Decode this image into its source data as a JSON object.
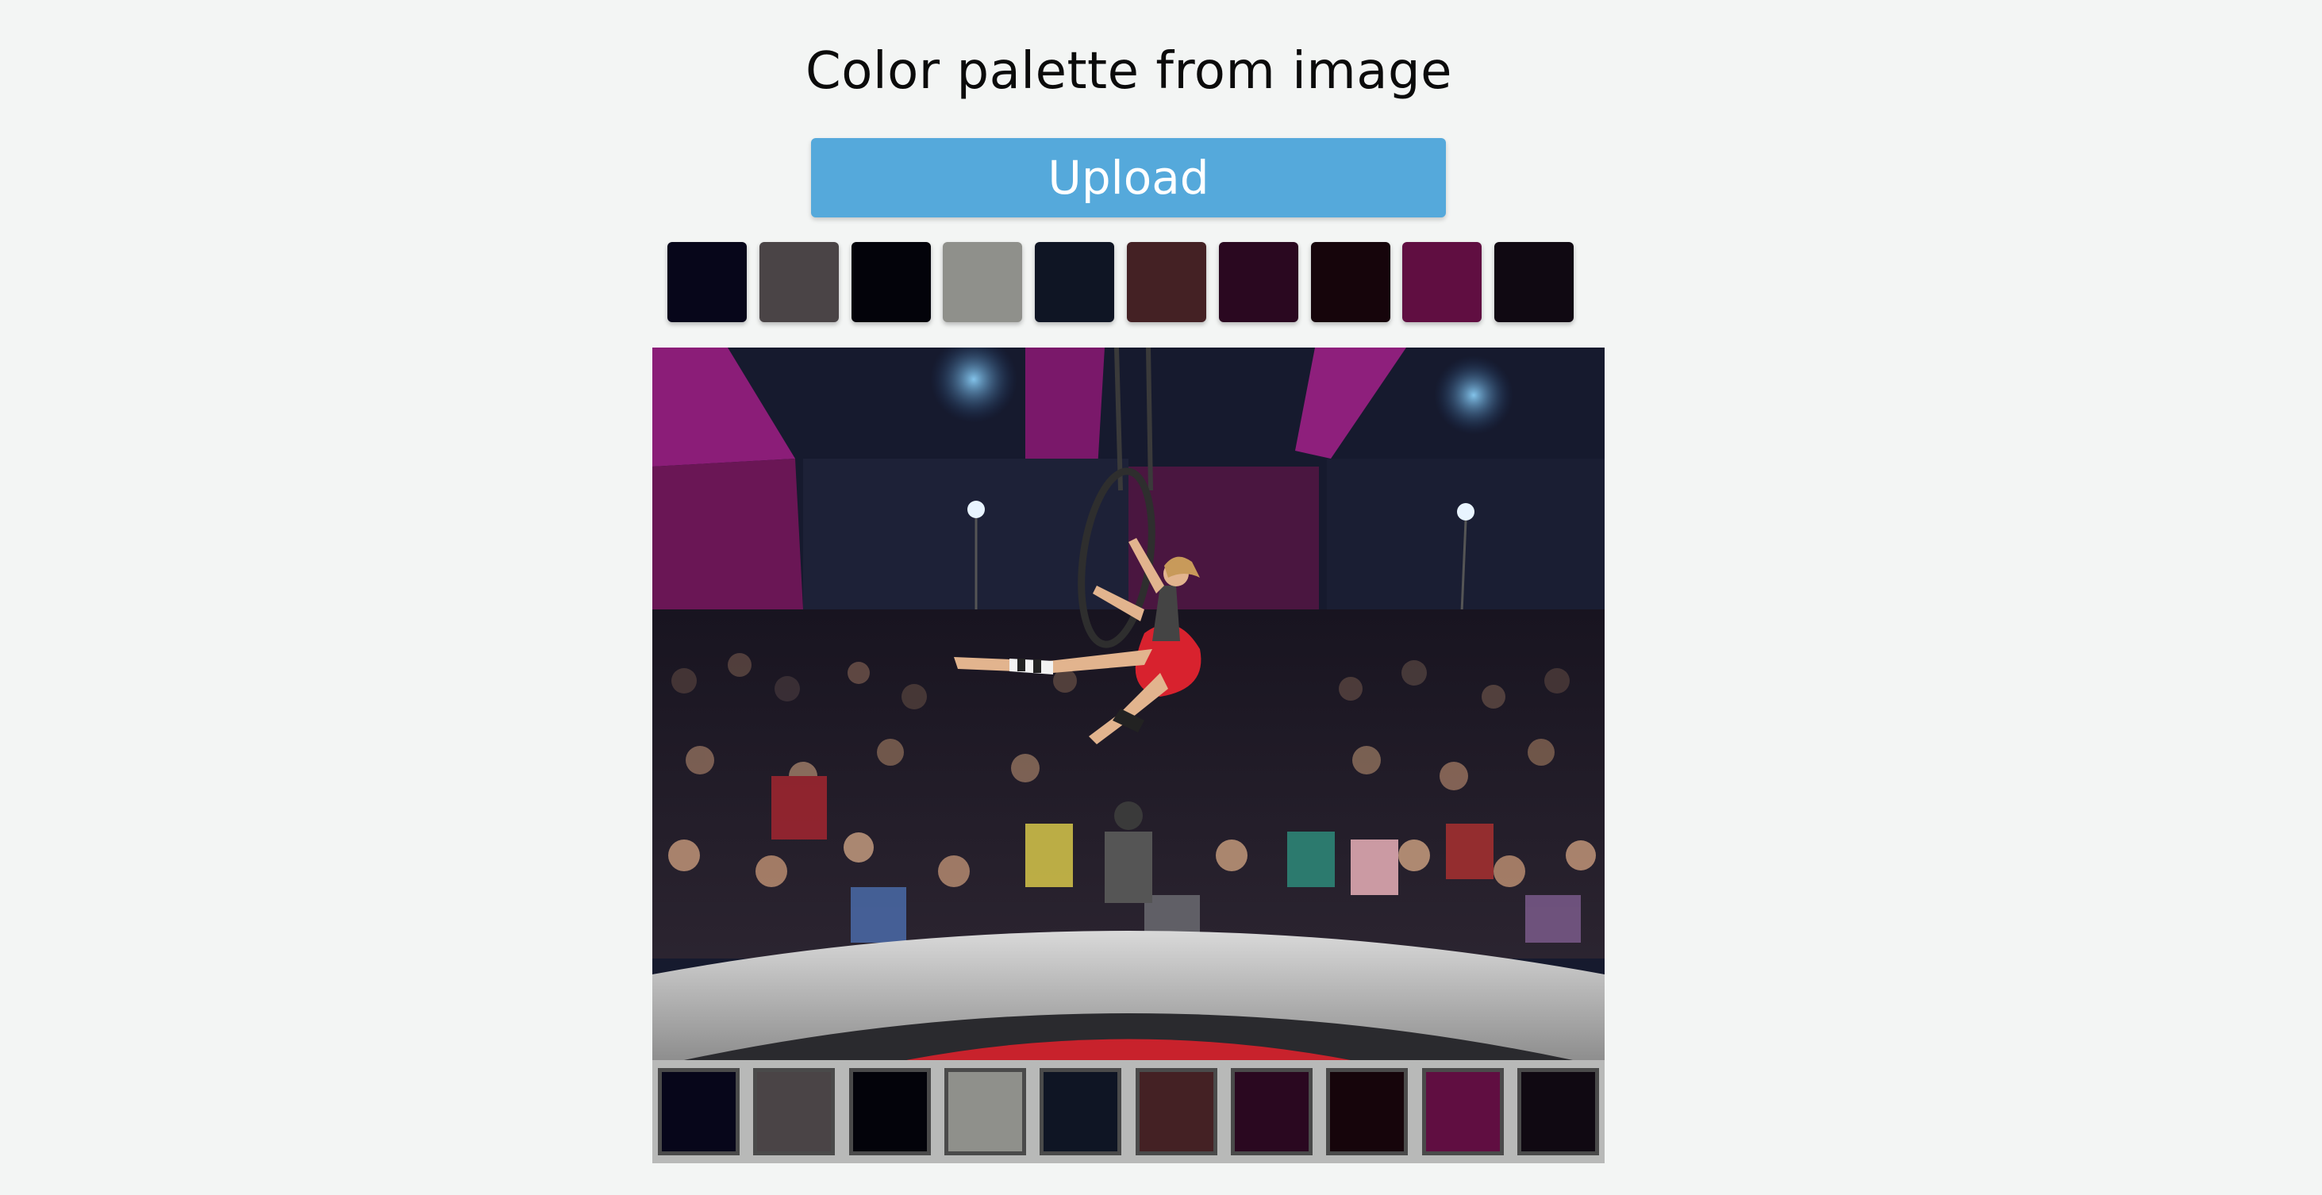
{
  "page": {
    "title": "Color palette from image"
  },
  "upload": {
    "label": "Upload",
    "color": "#55a9db"
  },
  "palette": [
    {
      "color": "#07061a"
    },
    {
      "color": "#4a4446"
    },
    {
      "color": "#03030a"
    },
    {
      "color": "#8f908b"
    },
    {
      "color": "#0f1524"
    },
    {
      "color": "#442124"
    },
    {
      "color": "#2a0820"
    },
    {
      "color": "#16050b"
    },
    {
      "color": "#600e41"
    },
    {
      "color": "#100912"
    }
  ],
  "image": {
    "subject": "aerial-hoop-performer-over-audience"
  }
}
